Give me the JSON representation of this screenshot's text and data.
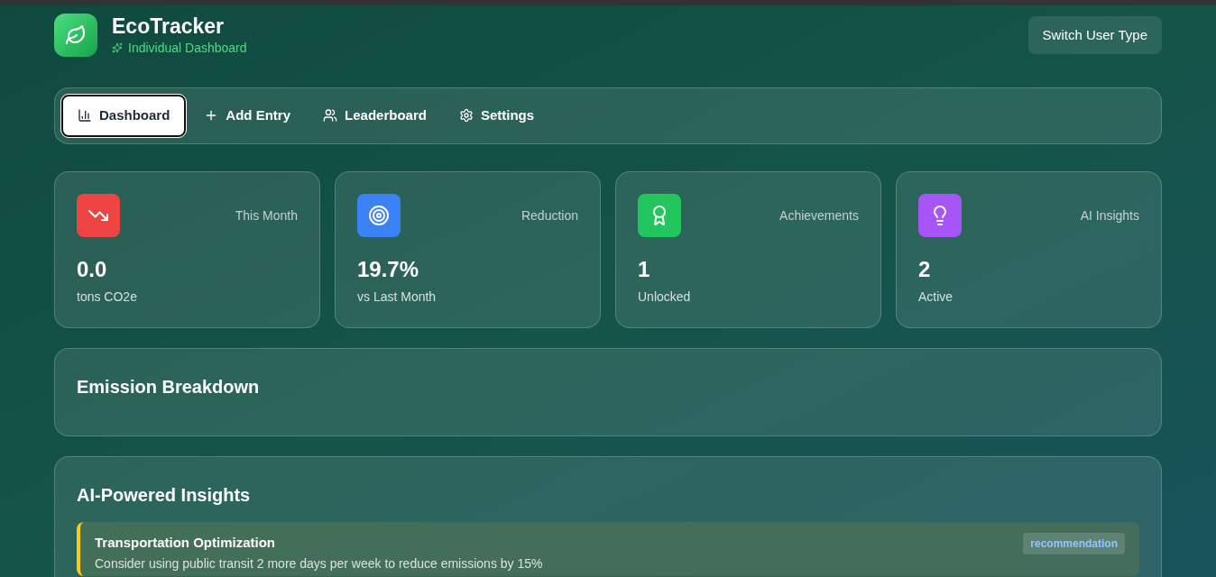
{
  "header": {
    "title": "EcoTracker",
    "subtitle": "Individual Dashboard",
    "switch_button": "Switch User Type"
  },
  "tabs": [
    {
      "label": "Dashboard",
      "kind": "chart",
      "selected": true
    },
    {
      "label": "Add Entry",
      "kind": "plus",
      "selected": false
    },
    {
      "label": "Leaderboard",
      "kind": "users",
      "selected": false
    },
    {
      "label": "Settings",
      "kind": "gear",
      "selected": false
    }
  ],
  "stats": [
    {
      "kind": "trend",
      "color": "#ef4444",
      "label": "This Month",
      "value": "0.0",
      "unit": "tons CO2e"
    },
    {
      "kind": "target",
      "color": "#3b82f6",
      "label": "Reduction",
      "value": "19.7%",
      "unit": "vs Last Month"
    },
    {
      "kind": "award",
      "color": "#22c55e",
      "label": "Achievements",
      "value": "1",
      "unit": "Unlocked"
    },
    {
      "kind": "bulb",
      "color": "#a855f7",
      "label": "AI Insights",
      "value": "2",
      "unit": "Active"
    }
  ],
  "emission_breakdown": {
    "title": "Emission Breakdown"
  },
  "insights": {
    "title": "AI-Powered Insights",
    "items": [
      {
        "title": "Transportation Optimization",
        "description": "Consider using public transit 2 more days per week to reduce emissions by 15%",
        "tag": "recommendation",
        "color": "#facc15"
      }
    ]
  }
}
